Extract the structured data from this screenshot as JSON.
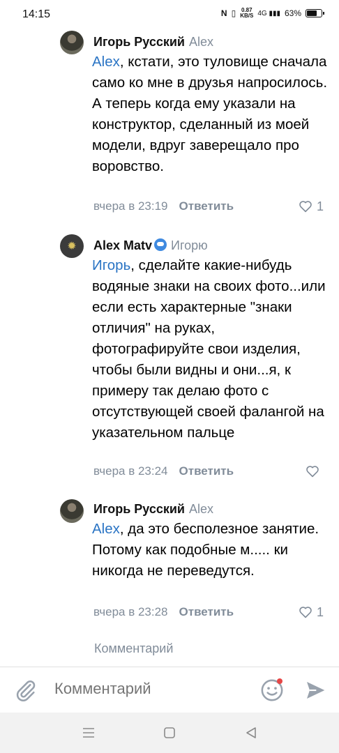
{
  "status": {
    "time": "14:15",
    "net_speed_top": "0.87",
    "net_speed_bottom": "KB/S",
    "network": "4G",
    "battery_text": "63%",
    "battery_level": 0.63
  },
  "comments": [
    {
      "author": "Игорь Русский",
      "reply_to": "Alex",
      "mention": "Alex",
      "text": ", кстати, это туловище сначала само ко мне в друзья напросилось. А теперь когда ему указали на конструктор, сделанный из моей модели, вдруг заверещало про воровство.",
      "time": "вчера в 23:19",
      "reply_label": "Ответить",
      "likes": "1"
    },
    {
      "author": "Alex Matv",
      "reply_to": "Игорю",
      "mention": "Игорь",
      "text": ", сделайте какие-нибудь водяные знаки на своих фото...или если есть характерные \"знаки отличия\" на руках, фотографируйте свои изделия, чтобы были видны и они...я, к примеру так делаю фото с отсутствующей своей фалангой на указательном пальце",
      "time": "вчера в 23:24",
      "reply_label": "Ответить",
      "likes": ""
    },
    {
      "author": "Игорь Русский",
      "reply_to": "Alex",
      "mention": "Alex",
      "text": ", да это бесполезное занятие. Потому как подобные м..... ки никогда не переведутся.",
      "time": "вчера в 23:28",
      "reply_label": "Ответить",
      "likes": "1"
    }
  ],
  "section_label": "Комментарий",
  "composer": {
    "placeholder": "Комментарий"
  },
  "colors": {
    "link": "#2a74c4",
    "secondary": "#818c99",
    "notification_dot": "#e64646"
  }
}
